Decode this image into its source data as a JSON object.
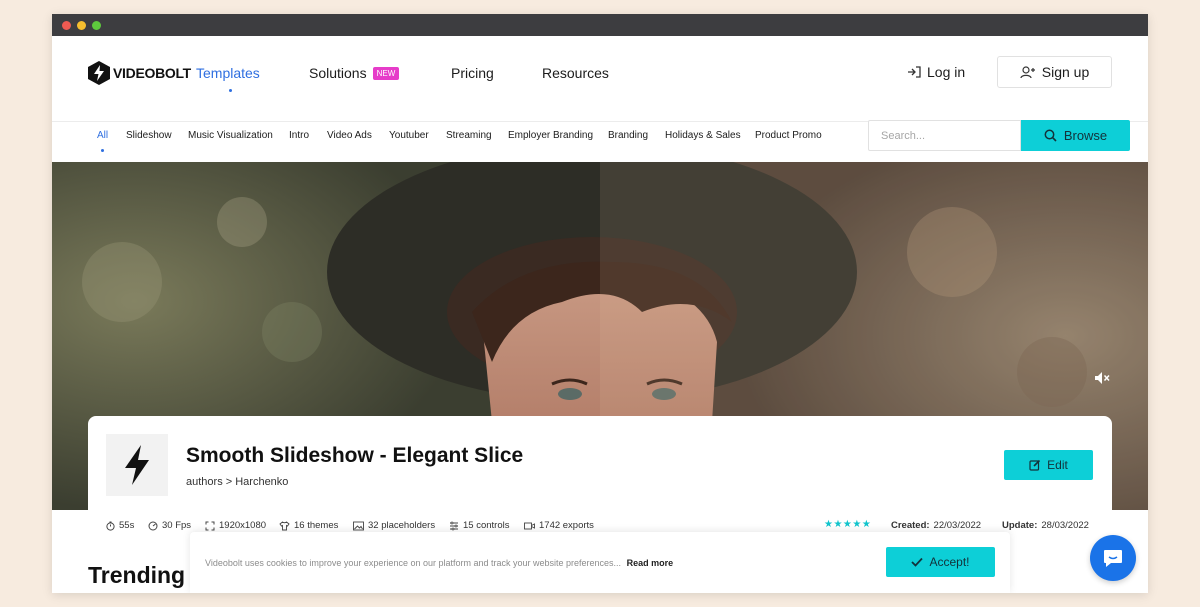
{
  "colors": {
    "accent": "#0dcfd7",
    "link_active": "#2f6fe0",
    "badge": "#e63cc9",
    "chat": "#1a73e8"
  },
  "nav": {
    "logo_text": "VIDEOBOLT",
    "links": [
      {
        "label": "Templates",
        "active": true
      },
      {
        "label": "Solutions",
        "badge": "NEW"
      },
      {
        "label": "Pricing"
      },
      {
        "label": "Resources"
      }
    ],
    "login": "Log in",
    "signup": "Sign up"
  },
  "categories": [
    "All",
    "Slideshow",
    "Music Visualization",
    "Intro",
    "Video Ads",
    "Youtuber",
    "Streaming",
    "Employer Branding",
    "Branding",
    "Holidays & Sales",
    "Product Promo"
  ],
  "search": {
    "placeholder": "Search...",
    "button": "Browse"
  },
  "template": {
    "title": "Smooth Slideshow - Elegant Slice",
    "author": "authors > Harchenko",
    "edit_button": "Edit",
    "stats": {
      "duration": "55s",
      "fps": "30 Fps",
      "resolution": "1920x1080",
      "themes": "16 themes",
      "placeholders": "32 placeholders",
      "controls": "15 controls",
      "exports": "1742 exports"
    },
    "rating": 5,
    "created_label": "Created:",
    "created": "22/03/2022",
    "update_label": "Update:",
    "updated": "28/03/2022"
  },
  "section_title": "Trending",
  "cookie": {
    "text": "Videobolt uses cookies to improve your experience on our platform and track your website preferences...",
    "read_more": "Read more",
    "accept": "Accept!"
  }
}
